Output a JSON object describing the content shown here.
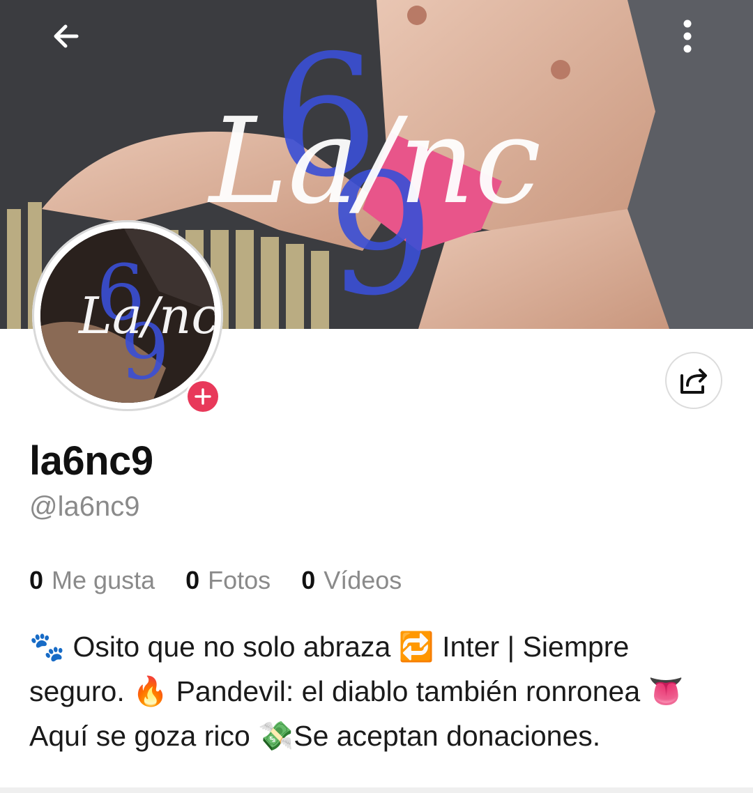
{
  "header": {
    "back_icon": "arrow-left-icon",
    "more_icon": "more-vertical-icon",
    "cover_watermark": "La6nc9"
  },
  "profile": {
    "display_name": "la6nc9",
    "handle": "@la6nc9",
    "add_icon": "plus-icon",
    "share_icon": "share-icon"
  },
  "stats": [
    {
      "value": "0",
      "label": "Me gusta"
    },
    {
      "value": "0",
      "label": "Fotos"
    },
    {
      "value": "0",
      "label": "Vídeos"
    }
  ],
  "bio": {
    "line1": "🐾 Osito que no solo abraza 🔁 Inter | Siempre",
    "line2": "seguro. 🔥 Pandevil: el diablo también ronronea 👅",
    "line3": "Aquí se goza rico 💸Se aceptan donaciones."
  },
  "colors": {
    "accent": "#e8395a",
    "logo_blue": "#3a4fd6",
    "muted_text": "#8a8a8a"
  }
}
